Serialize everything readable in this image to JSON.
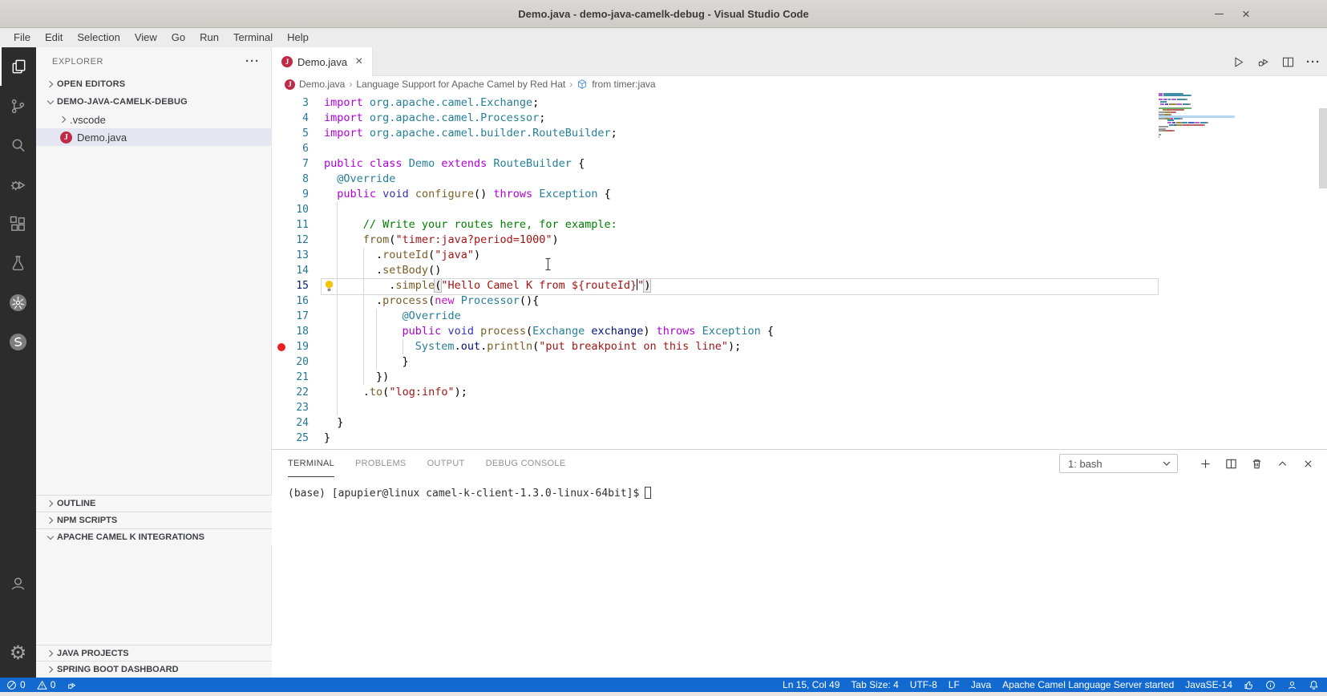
{
  "colors": {
    "status_bar": "#1269cf",
    "activity_bar": "#2c2c2c",
    "file_badge": "#bf2b47",
    "breakpoint": "#e52222",
    "selected_row": "#e4e6f1"
  },
  "window": {
    "title": "Demo.java - demo-java-camelk-debug - Visual Studio Code",
    "close_label": "×"
  },
  "menu": {
    "items": [
      "File",
      "Edit",
      "Selection",
      "View",
      "Go",
      "Run",
      "Terminal",
      "Help"
    ]
  },
  "sidebar": {
    "title": "EXPLORER",
    "more": "···",
    "open_editors": "OPEN EDITORS",
    "project": "DEMO-JAVA-CAMELK-DEBUG",
    "vscode_folder": ".vscode",
    "file": "Demo.java",
    "file_badge": "J",
    "sections": [
      "OUTLINE",
      "NPM SCRIPTS",
      "APACHE CAMEL K INTEGRATIONS"
    ],
    "footer_sections": [
      "JAVA PROJECTS",
      "SPRING BOOT DASHBOARD"
    ]
  },
  "editor": {
    "tab": {
      "label": "Demo.java",
      "badge": "J",
      "close": "×"
    },
    "breadcrumbs": [
      "Demo.java",
      "Language Support for Apache Camel by Red Hat",
      "from timer:java"
    ],
    "code": {
      "lines": [
        {
          "n": 3,
          "segs": [
            [
              "kw",
              "import"
            ],
            [
              "pl",
              " "
            ],
            [
              "ty",
              "org.apache.camel.Exchange"
            ],
            [
              "pl",
              ";"
            ]
          ]
        },
        {
          "n": 4,
          "segs": [
            [
              "kw",
              "import"
            ],
            [
              "pl",
              " "
            ],
            [
              "ty",
              "org.apache.camel.Processor"
            ],
            [
              "pl",
              ";"
            ]
          ]
        },
        {
          "n": 5,
          "segs": [
            [
              "kw",
              "import"
            ],
            [
              "pl",
              " "
            ],
            [
              "ty",
              "org.apache.camel.builder.RouteBuilder"
            ],
            [
              "pl",
              ";"
            ]
          ]
        },
        {
          "n": 6,
          "segs": []
        },
        {
          "n": 7,
          "segs": [
            [
              "kw",
              "public"
            ],
            [
              "pl",
              " "
            ],
            [
              "kw",
              "class"
            ],
            [
              "pl",
              " "
            ],
            [
              "ty",
              "Demo"
            ],
            [
              "pl",
              " "
            ],
            [
              "kw",
              "extends"
            ],
            [
              "pl",
              " "
            ],
            [
              "ty",
              "RouteBuilder"
            ],
            [
              "pl",
              " {"
            ]
          ]
        },
        {
          "n": 8,
          "segs": [
            [
              "pl",
              "  "
            ],
            [
              "ty",
              "@Override"
            ]
          ]
        },
        {
          "n": 9,
          "segs": [
            [
              "pl",
              "  "
            ],
            [
              "kw",
              "public"
            ],
            [
              "pl",
              " "
            ],
            [
              "kwv",
              "void"
            ],
            [
              "pl",
              " "
            ],
            [
              "fn",
              "configure"
            ],
            [
              "pl",
              "() "
            ],
            [
              "kw",
              "throws"
            ],
            [
              "pl",
              " "
            ],
            [
              "ty",
              "Exception"
            ],
            [
              "pl",
              " {"
            ]
          ]
        },
        {
          "n": 10,
          "segs": []
        },
        {
          "n": 11,
          "segs": [
            [
              "cm",
              "      // Write your routes here, for example:"
            ]
          ]
        },
        {
          "n": 12,
          "segs": [
            [
              "pl",
              "      "
            ],
            [
              "fn",
              "from"
            ],
            [
              "pl",
              "("
            ],
            [
              "str",
              "\"timer:java?period=1000\""
            ],
            [
              "pl",
              ")"
            ]
          ]
        },
        {
          "n": 13,
          "segs": [
            [
              "pl",
              "        ."
            ],
            [
              "fn",
              "routeId"
            ],
            [
              "pl",
              "("
            ],
            [
              "str",
              "\"java\""
            ],
            [
              "pl",
              ")"
            ]
          ]
        },
        {
          "n": 14,
          "segs": [
            [
              "pl",
              "        ."
            ],
            [
              "fn",
              "setBody"
            ],
            [
              "pl",
              "()"
            ]
          ]
        },
        {
          "n": 15,
          "current": true,
          "lightbulb": true,
          "segs": [
            [
              "pl",
              "          ."
            ],
            [
              "fn",
              "simple"
            ],
            [
              "bm",
              "("
            ],
            [
              "str",
              "\"Hello Camel K from ${routeId}"
            ],
            [
              "cur",
              ""
            ],
            [
              "str",
              "\""
            ],
            [
              "bm",
              ")"
            ]
          ]
        },
        {
          "n": 16,
          "segs": [
            [
              "pl",
              "        ."
            ],
            [
              "fn",
              "process"
            ],
            [
              "pl",
              "("
            ],
            [
              "kwn",
              "new"
            ],
            [
              "pl",
              " "
            ],
            [
              "ty",
              "Processor"
            ],
            [
              "pl",
              "(){"
            ]
          ]
        },
        {
          "n": 17,
          "segs": [
            [
              "pl",
              "            "
            ],
            [
              "ty",
              "@Override"
            ]
          ]
        },
        {
          "n": 18,
          "segs": [
            [
              "pl",
              "            "
            ],
            [
              "kw",
              "public"
            ],
            [
              "pl",
              " "
            ],
            [
              "kwv",
              "void"
            ],
            [
              "pl",
              " "
            ],
            [
              "fn",
              "process"
            ],
            [
              "pl",
              "("
            ],
            [
              "ty",
              "Exchange"
            ],
            [
              "pl",
              " "
            ],
            [
              "vr",
              "exchange"
            ],
            [
              "pl",
              ") "
            ],
            [
              "kw",
              "throws"
            ],
            [
              "pl",
              " "
            ],
            [
              "ty",
              "Exception"
            ],
            [
              "pl",
              " {"
            ]
          ]
        },
        {
          "n": 19,
          "breakpoint": true,
          "segs": [
            [
              "pl",
              "              "
            ],
            [
              "ty",
              "System"
            ],
            [
              "pl",
              "."
            ],
            [
              "vr",
              "out"
            ],
            [
              "pl",
              "."
            ],
            [
              "fn",
              "println"
            ],
            [
              "pl",
              "("
            ],
            [
              "str",
              "\"put breakpoint on this line\""
            ],
            [
              "pl",
              ");"
            ]
          ]
        },
        {
          "n": 20,
          "segs": [
            [
              "pl",
              "            }"
            ]
          ]
        },
        {
          "n": 21,
          "segs": [
            [
              "pl",
              "        })"
            ]
          ]
        },
        {
          "n": 22,
          "segs": [
            [
              "pl",
              "      ."
            ],
            [
              "fn",
              "to"
            ],
            [
              "pl",
              "("
            ],
            [
              "str",
              "\"log:info\""
            ],
            [
              "pl",
              ");"
            ]
          ]
        },
        {
          "n": 23,
          "segs": []
        },
        {
          "n": 24,
          "segs": [
            [
              "pl",
              "  }"
            ]
          ]
        },
        {
          "n": 25,
          "segs": [
            [
              "pl",
              "}"
            ]
          ]
        }
      ]
    }
  },
  "panel": {
    "tabs": [
      "TERMINAL",
      "PROBLEMS",
      "OUTPUT",
      "DEBUG CONSOLE"
    ],
    "active_tab": "TERMINAL",
    "shell_select": "1: bash",
    "prompt": "(base) [apupier@linux camel-k-client-1.3.0-linux-64bit]$"
  },
  "status_bar": {
    "errors": "0",
    "warnings": "0",
    "items_right": [
      "Ln 15, Col 49",
      "Tab Size: 4",
      "UTF-8",
      "LF",
      "Java",
      "Apache Camel Language Server started",
      "JavaSE-14"
    ]
  }
}
